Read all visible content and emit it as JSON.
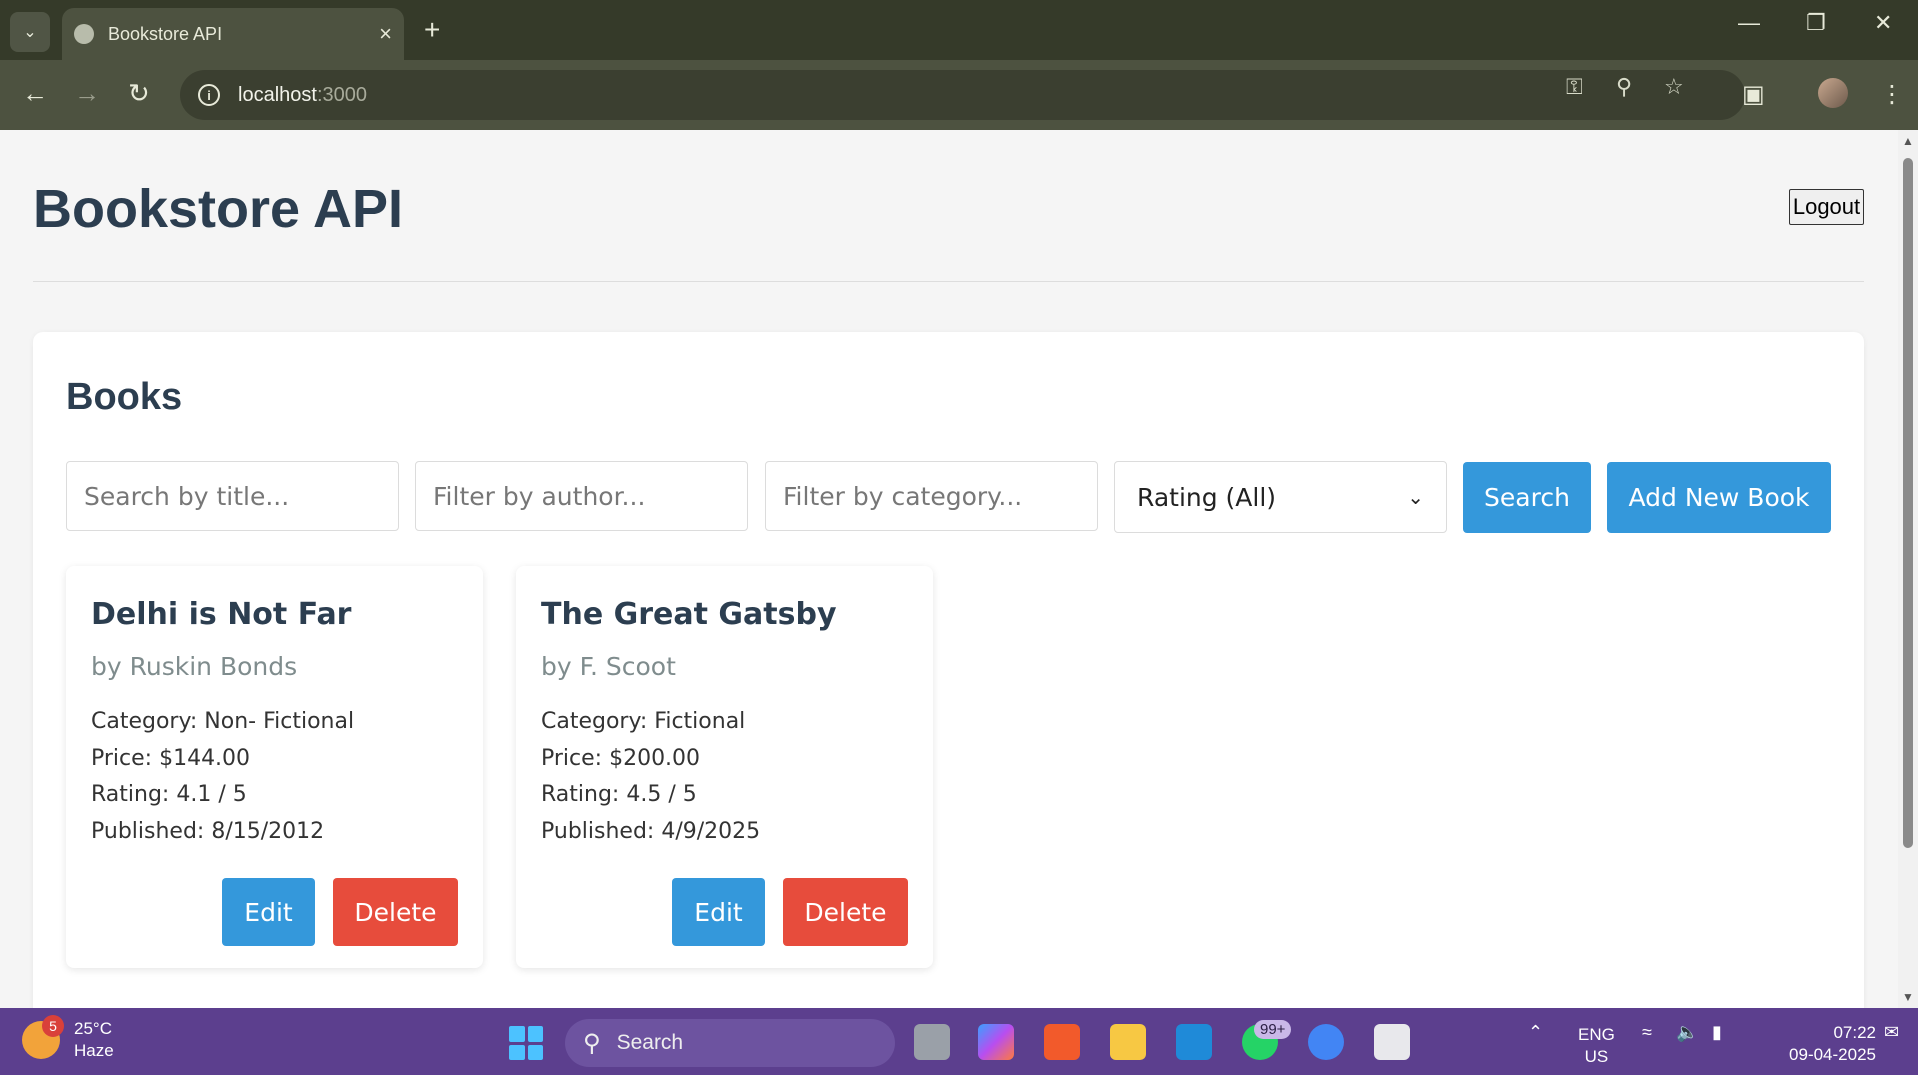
{
  "browser": {
    "tab_title": "Bookstore API",
    "url_host": "localhost",
    "url_port": ":3000"
  },
  "app": {
    "title": "Bookstore API",
    "logout_label": "Logout"
  },
  "books_section": {
    "title": "Books",
    "filters": {
      "title_placeholder": "Search by title...",
      "author_placeholder": "Filter by author...",
      "category_placeholder": "Filter by category...",
      "rating_selected": "Rating (All)"
    },
    "search_label": "Search",
    "add_label": "Add New Book",
    "books": [
      {
        "title": "Delhi is Not Far",
        "author": "by Ruskin Bonds",
        "category": "Category: Non- Fictional",
        "price": "Price: $144.00",
        "rating": "Rating: 4.1 / 5",
        "published": "Published: 8/15/2012",
        "edit_label": "Edit",
        "delete_label": "Delete"
      },
      {
        "title": "The Great Gatsby",
        "author": "by F. Scoot",
        "category": "Category: Fictional",
        "price": "Price: $200.00",
        "rating": "Rating: 4.5 / 5",
        "published": "Published: 4/9/2025",
        "edit_label": "Edit",
        "delete_label": "Delete"
      }
    ]
  },
  "taskbar": {
    "weather_badge": "5",
    "temperature": "25°C",
    "condition": "Haze",
    "search_label": "Search",
    "whatsapp_badge": "99+",
    "lang_top": "ENG",
    "lang_bottom": "US",
    "time": "07:22",
    "date": "09-04-2025"
  },
  "colors": {
    "primary": "#3498db",
    "danger": "#e74c3c",
    "heading": "#2c3e50"
  }
}
